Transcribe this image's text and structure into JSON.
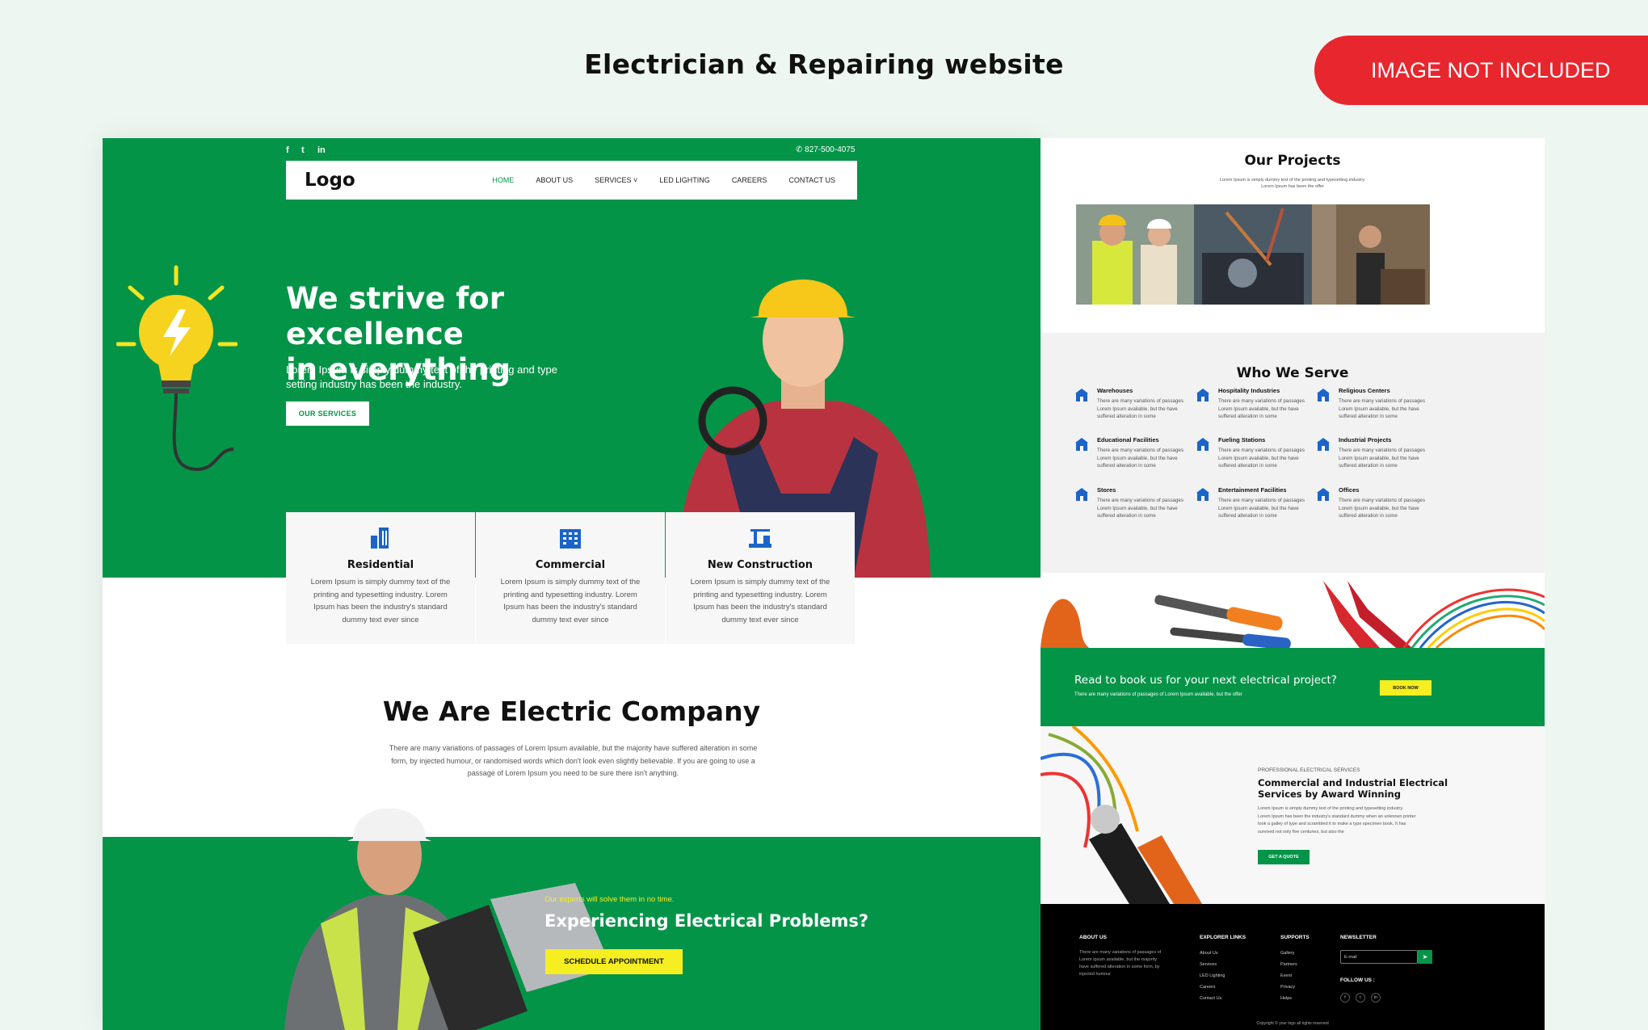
{
  "header": {
    "title": "Electrician & Repairing website",
    "badge": "IMAGE NOT INCLUDED"
  },
  "left": {
    "topbar": {
      "phone": "827-500-4075",
      "social": [
        "f",
        "t",
        "in"
      ]
    },
    "nav": {
      "logo": "Logo",
      "items": [
        "HOME",
        "ABOUT US",
        "SERVICES",
        "LED LIGHTING",
        "CAREERS",
        "CONTACT US"
      ],
      "active": "HOME"
    },
    "hero": {
      "title_line1": "We strive for excellence",
      "title_line2": "in everything",
      "subtitle_line1": "Lorem Ipsum is simply dummy text of the printing and type",
      "subtitle_line2": "setting industry has been the industry.",
      "button": "OUR SERVICES"
    },
    "cards": [
      {
        "title": "Residential",
        "l1": "Lorem Ipsum is simply dummy text of the",
        "l2": "printing and typesetting industry. Lorem",
        "l3": "Ipsum has been the industry's standard",
        "l4": "dummy text ever since"
      },
      {
        "title": "Commercial",
        "l1": "Lorem Ipsum is simply dummy text of the",
        "l2": "printing and typesetting industry. Lorem",
        "l3": "Ipsum has been the industry's standard",
        "l4": "dummy text ever since"
      },
      {
        "title": "New Construction",
        "l1": "Lorem Ipsum is simply dummy text of the",
        "l2": "printing and typesetting industry. Lorem",
        "l3": "Ipsum has been the industry's standard",
        "l4": "dummy text ever since"
      }
    ],
    "about": {
      "title": "We Are Electric Company",
      "l1": "There are many variations of passages of Lorem Ipsum available, but the majority have suffered alteration in some",
      "l2": "form, by injected humour, or randomised words which don't look even slightly believable. If you are going to use a",
      "l3": "passage of Lorem Ipsum you need to be sure there isn't anything."
    },
    "band": {
      "kicker": "Our experts will solve them in no time.",
      "title": "Experiencing Electrical Problems?",
      "button": "SCHEDULE APPOINTMENT"
    }
  },
  "right": {
    "projects": {
      "title": "Our Projects",
      "l1": "Lorem Ipsum is simply dummy text of the printing and typesetting industry.",
      "l2": "Lorem Ipsum has been the offer"
    },
    "serve": {
      "title": "Who We Serve",
      "desc1": "There are many variations of passages",
      "desc2": "Lorem Ipsum available, but the  have",
      "desc3": "suffered alteration in some",
      "items": [
        "Warehouses",
        "Hospitality Industries",
        "Religious Centers",
        "Educational Facilities",
        "Fueling Stations",
        "Industrial Projects",
        "Stores",
        "Entertainment Facilities",
        "Offices"
      ]
    },
    "cta": {
      "title": "Read to book us for your next electrical project?",
      "subtitle": "There are many variations of passages of Lorem Ipsum available, but the offer",
      "button": "BOOK NOW"
    },
    "pro": {
      "kicker": "PROFESSIONAL ELECTRICAL SERVICES",
      "title_l1": "Commercial and Industrial Electrical",
      "title_l2": "Services by Award Winning",
      "l1": "Lorem Ipsum is simply dummy text of the printing and typesetting industry.",
      "l2": "Lorem Ipsum has been the industry's standard dummy when an unknown printer",
      "l3": "took a galley of type and scrambled it to make a type specimen book. It has",
      "l4": "survived not only five centuries, but also the",
      "button": "GET A QUOTE"
    },
    "footer": {
      "about_title": "ABOUT US",
      "about_l1": "There are many variations of passages of",
      "about_l2": "Lorem Ipsum available, but the majority",
      "about_l3": "have suffered alteration in some form, by",
      "about_l4": "injected humour",
      "links_title": "EXPLORER LINKS",
      "links": [
        "About Us",
        "Services",
        "LED Lighting",
        "Careers",
        "Contact Us"
      ],
      "supports_title": "SUPPORTS",
      "supports": [
        "Gallery",
        "Partners",
        "Event",
        "Privacy",
        "Helps"
      ],
      "newsletter_title": "NEWSLETTER",
      "email_placeholder": "E-mail",
      "follow": "FOLLOW US :",
      "copyright": "Copyright © your logo all rights reserved"
    }
  }
}
